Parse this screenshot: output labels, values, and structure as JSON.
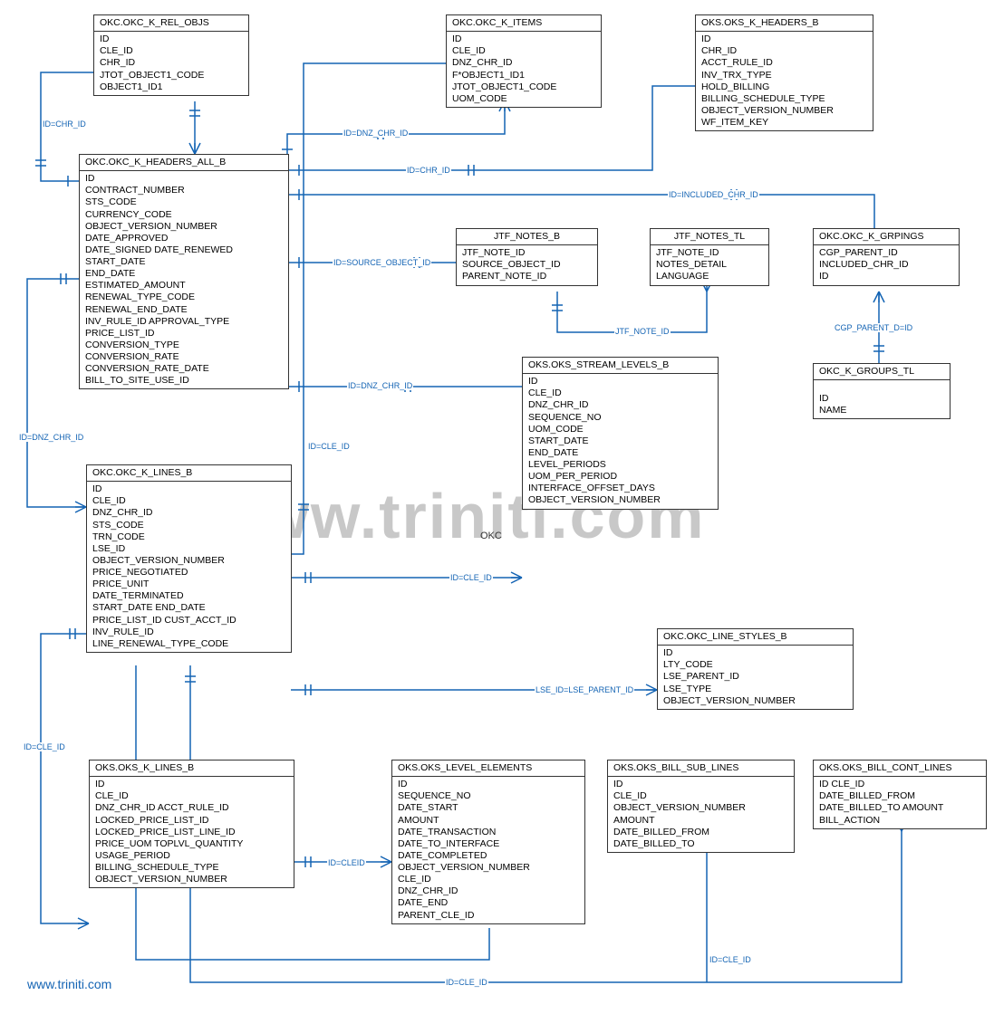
{
  "watermark": "www.triniti.com",
  "footer_link": "www.triniti.com",
  "okc_label": "OKC",
  "entities": {
    "okc_k_rel_objs": {
      "title": "OKC.OKC_K_REL_OBJS",
      "cols": [
        "ID",
        "CLE_ID",
        "CHR_ID",
        "JTOT_OBJECT1_CODE",
        "OBJECT1_ID1"
      ]
    },
    "okc_k_items": {
      "title": "OKC.OKC_K_ITEMS",
      "cols": [
        "ID",
        "CLE_ID",
        "DNZ_CHR_ID",
        "F*OBJECT1_ID1",
        "JTOT_OBJECT1_CODE",
        "UOM_CODE"
      ]
    },
    "oks_k_headers_b": {
      "title": "OKS.OKS_K_HEADERS_B",
      "cols": [
        "ID",
        "CHR_ID",
        "ACCT_RULE_ID",
        "INV_TRX_TYPE",
        "HOLD_BILLING",
        "BILLING_SCHEDULE_TYPE",
        "OBJECT_VERSION_NUMBER",
        "WF_ITEM_KEY"
      ]
    },
    "okc_k_headers_all_b": {
      "title": "OKC.OKC_K_HEADERS_ALL_B",
      "cols": [
        "ID",
        "CONTRACT_NUMBER",
        "STS_CODE",
        "CURRENCY_CODE",
        "OBJECT_VERSION_NUMBER",
        "DATE_APPROVED",
        "DATE_SIGNED DATE_RENEWED",
        "START_DATE",
        "END_DATE",
        "ESTIMATED_AMOUNT",
        "RENEWAL_TYPE_CODE",
        "RENEWAL_END_DATE",
        "INV_RULE_ID APPROVAL_TYPE",
        "PRICE_LIST_ID",
        "CONVERSION_TYPE",
        "CONVERSION_RATE",
        "CONVERSION_RATE_DATE",
        "BILL_TO_SITE_USE_ID"
      ]
    },
    "jtf_notes_b": {
      "title": "JTF_NOTES_B",
      "cols": [
        "JTF_NOTE_ID",
        "SOURCE_OBJECT_ID",
        "PARENT_NOTE_ID"
      ]
    },
    "jtf_notes_tl": {
      "title": "JTF_NOTES_TL",
      "cols": [
        "JTF_NOTE_ID",
        "NOTES_DETAIL",
        "LANGUAGE"
      ]
    },
    "okc_k_grpings": {
      "title": "OKC.OKC_K_GRPINGS",
      "cols": [
        "CGP_PARENT_ID",
        "INCLUDED_CHR_ID",
        "ID"
      ]
    },
    "oks_stream_levels_b": {
      "title": "OKS.OKS_STREAM_LEVELS_B",
      "cols": [
        "ID",
        "CLE_ID",
        "DNZ_CHR_ID",
        "SEQUENCE_NO",
        "UOM_CODE",
        "START_DATE",
        "END_DATE",
        "LEVEL_PERIODS",
        "UOM_PER_PERIOD",
        "INTERFACE_OFFSET_DAYS",
        "OBJECT_VERSION_NUMBER"
      ]
    },
    "okc_k_groups_tl": {
      "title": "OKC_K_GROUPS_TL",
      "cols": [
        "ID",
        "NAME"
      ]
    },
    "okc_k_lines_b": {
      "title": "OKC.OKC_K_LINES_B",
      "cols": [
        "ID",
        "CLE_ID",
        "DNZ_CHR_ID",
        "STS_CODE",
        "TRN_CODE",
        "LSE_ID",
        "OBJECT_VERSION_NUMBER",
        "PRICE_NEGOTIATED",
        "PRICE_UNIT",
        "DATE_TERMINATED",
        "START_DATE END_DATE",
        "PRICE_LIST_ID CUST_ACCT_ID",
        "INV_RULE_ID",
        "LINE_RENEWAL_TYPE_CODE"
      ]
    },
    "okc_line_styles_b": {
      "title": "OKC.OKC_LINE_STYLES_B",
      "cols": [
        "ID",
        "LTY_CODE",
        "LSE_PARENT_ID",
        "LSE_TYPE",
        "OBJECT_VERSION_NUMBER"
      ]
    },
    "oks_k_lines_b": {
      "title": "OKS.OKS_K_LINES_B",
      "cols": [
        "ID",
        "CLE_ID",
        "DNZ_CHR_ID ACCT_RULE_ID",
        "LOCKED_PRICE_LIST_ID",
        "LOCKED_PRICE_LIST_LINE_ID",
        "PRICE_UOM TOPLVL_QUANTITY",
        "USAGE_PERIOD",
        "BILLING_SCHEDULE_TYPE",
        "OBJECT_VERSION_NUMBER"
      ]
    },
    "oks_level_elements": {
      "title": "OKS.OKS_LEVEL_ELEMENTS",
      "cols": [
        "ID",
        "SEQUENCE_NO",
        "DATE_START",
        "AMOUNT",
        "DATE_TRANSACTION",
        "DATE_TO_INTERFACE",
        "DATE_COMPLETED",
        "OBJECT_VERSION_NUMBER",
        "CLE_ID",
        "DNZ_CHR_ID",
        "DATE_END",
        "PARENT_CLE_ID"
      ]
    },
    "oks_bill_sub_lines": {
      "title": "OKS.OKS_BILL_SUB_LINES",
      "cols": [
        "ID",
        "CLE_ID",
        "OBJECT_VERSION_NUMBER",
        "AMOUNT",
        "DATE_BILLED_FROM",
        "DATE_BILLED_TO"
      ]
    },
    "oks_bill_cont_lines": {
      "title": "OKS.OKS_BILL_CONT_LINES",
      "cols": [
        "ID CLE_ID",
        "DATE_BILLED_FROM",
        "DATE_BILLED_TO AMOUNT",
        "BILL_ACTION"
      ]
    }
  },
  "labels": {
    "id_chr_id": "ID=CHR_ID",
    "id_dnz_chr_id": "ID=DNZ_CHR_ID",
    "id_included_chr_id": "ID=INCLUDED_CHR_ID",
    "id_source_object_id": "ID=SOURCE_OBJECT_ID",
    "jtf_note_id": "JTF_NOTE_ID",
    "cgp_parent_d_id": "CGP_PARENT_D=ID",
    "id_cle_id": "ID=CLE_ID",
    "id_cleid": "ID=CLEID",
    "lse_id_lse_parent_id": "LSE_ID=LSE_PARENT_ID"
  }
}
